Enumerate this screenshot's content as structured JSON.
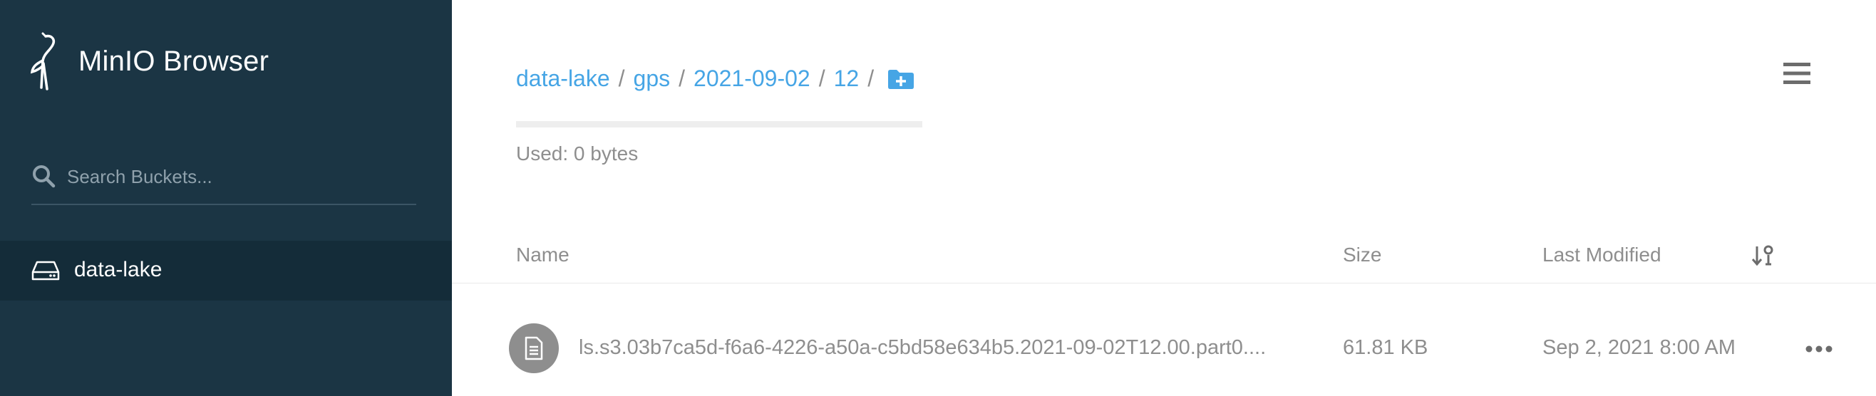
{
  "app": {
    "title": "MinIO Browser"
  },
  "sidebar": {
    "search_placeholder": "Search Buckets...",
    "buckets": [
      {
        "label": "data-lake",
        "icon": "drive-icon",
        "active": true
      }
    ]
  },
  "breadcrumb": {
    "items": [
      "data-lake",
      "gps",
      "2021-09-02",
      "12"
    ],
    "separator": "/",
    "add_folder_icon": "add-folder-icon"
  },
  "usage": {
    "text": "Used: 0 bytes",
    "fraction": 0
  },
  "table": {
    "headers": {
      "name": "Name",
      "size": "Size",
      "modified": "Last Modified"
    },
    "rows": [
      {
        "name": "ls.s3.03b7ca5d-f6a6-4226-a50a-c5bd58e634b5.2021-09-02T12.00.part0....",
        "size": "61.81 KB",
        "modified": "Sep 2, 2021 8:00 AM"
      }
    ]
  },
  "colors": {
    "sidebar_bg": "#1b3544",
    "sidebar_active": "#142c39",
    "accent": "#46a5e5",
    "muted_text": "#8e8e8e"
  }
}
